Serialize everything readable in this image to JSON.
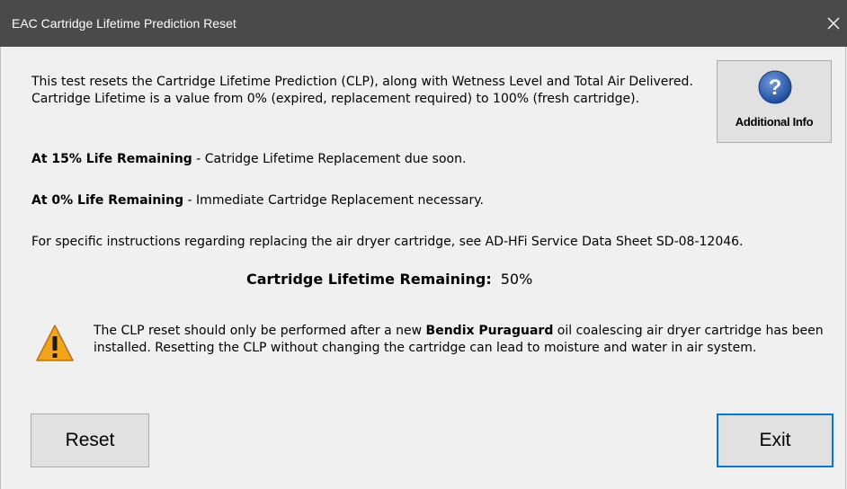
{
  "window": {
    "title": "EAC Cartridge Lifetime Prediction Reset",
    "close_label": "✕"
  },
  "intro": "This test resets the Cartridge Lifetime Prediction (CLP), along with Wetness Level and Total Air Delivered. Cartridge Lifetime is a value from 0% (expired, replacement required) to 100% (fresh cartridge).",
  "levels": [
    {
      "heading": "At 15% Life Remaining",
      "text": " - Catridge Lifetime Replacement due soon."
    },
    {
      "heading": "At 0% Life Remaining",
      "text": " - Immediate Cartridge Replacement necessary."
    }
  ],
  "instructions": "For specific instructions regarding replacing the air dryer cartridge, see AD-HFi Service Data Sheet SD-08-12046.",
  "lifetime": {
    "label": "Cartridge Lifetime Remaining:",
    "value": "50%"
  },
  "warning": {
    "icon": "warning-icon",
    "text_before": "The CLP reset should only be performed after a new ",
    "brand": "Bendix Puraguard",
    "text_after": " oil coalescing air dryer cartridge has been installed. Resetting the CLP without changing the cartridge can lead to moisture and water in air system."
  },
  "buttons": {
    "info": {
      "label": "Additional Info",
      "icon": "help-icon"
    },
    "reset": "Reset",
    "exit": "Exit"
  },
  "colors": {
    "titlebar": "#4a4a4a",
    "info_icon": "#2e5faf",
    "warning_icon": "#f4a41a",
    "default_button_border": "#0078d7"
  }
}
